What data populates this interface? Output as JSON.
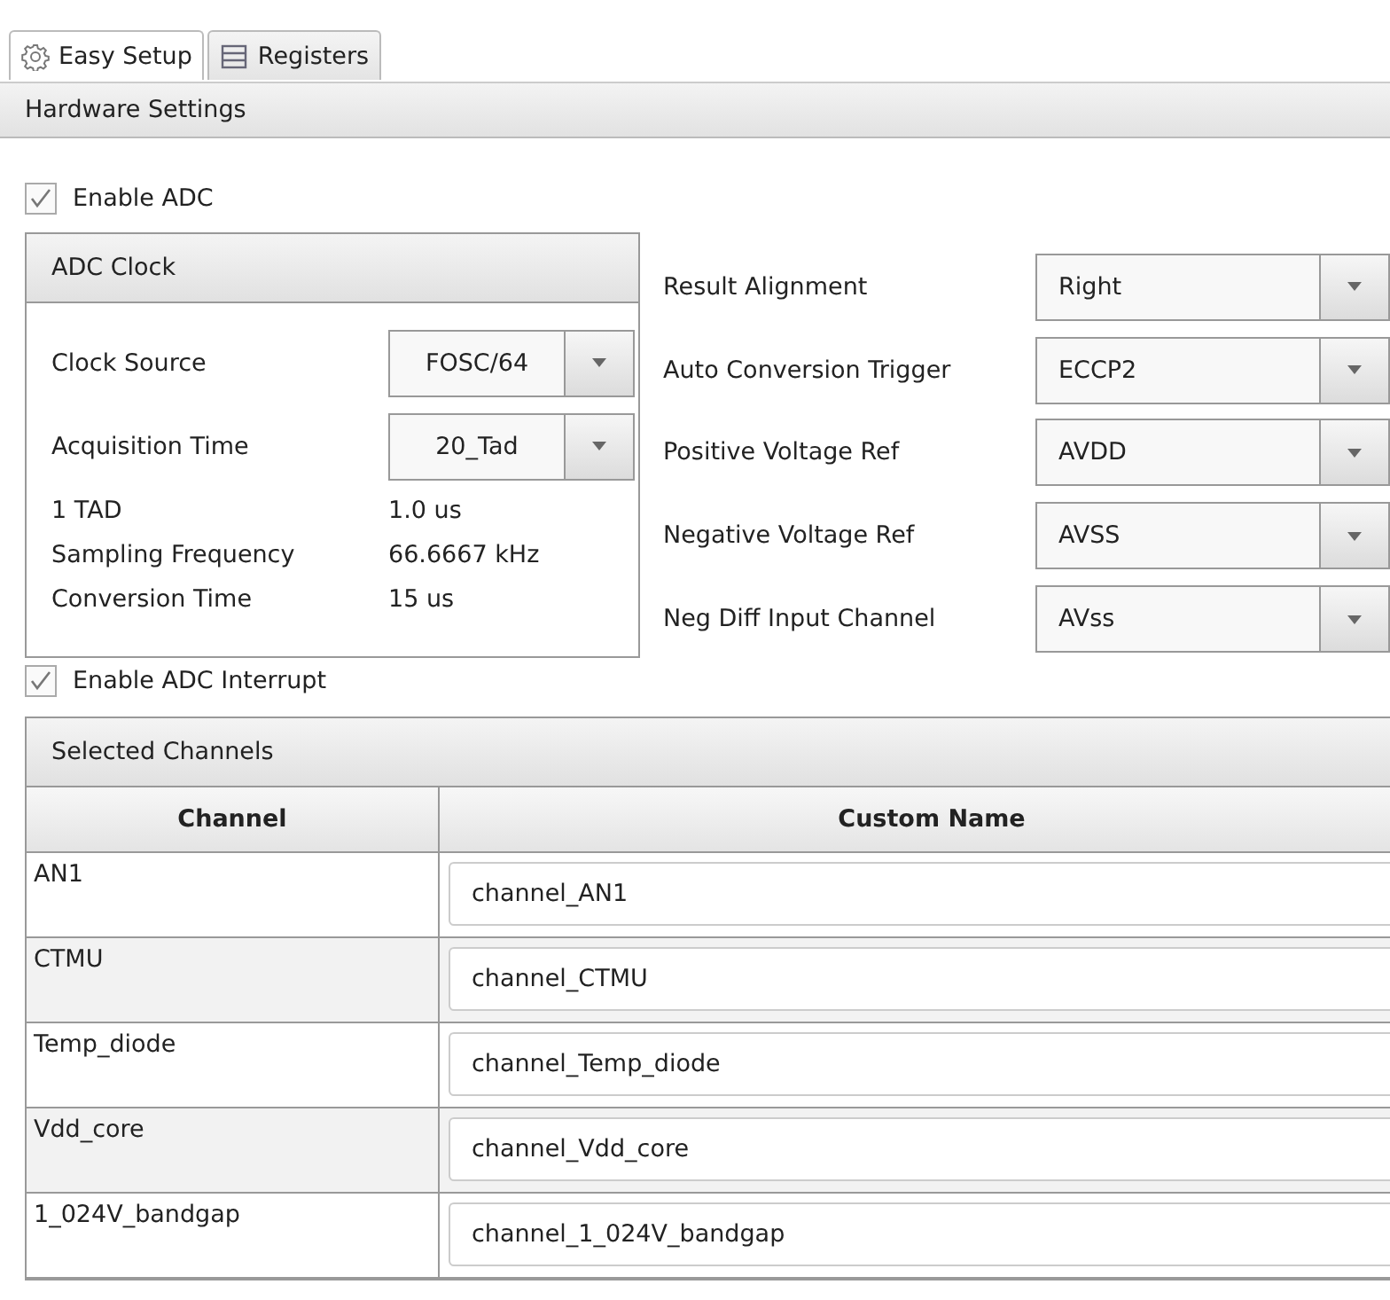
{
  "tabs": [
    {
      "label": "Easy Setup",
      "kind": "setup",
      "selected": true
    },
    {
      "label": "Registers",
      "kind": "registers",
      "selected": false
    }
  ],
  "section_title": "Hardware Settings",
  "enable_adc": {
    "label": "Enable ADC",
    "checked": true
  },
  "adc_clock": {
    "title": "ADC Clock",
    "dropdowns": [
      {
        "label": "Clock Source",
        "value": "FOSC/64"
      },
      {
        "label": "Acquisition Time",
        "value": "20_Tad"
      }
    ],
    "readouts": [
      {
        "label": "1 TAD",
        "value": "1.0 us"
      },
      {
        "label": "Sampling Frequency",
        "value": "66.6667 kHz"
      },
      {
        "label": "Conversion Time",
        "value": "15 us"
      }
    ]
  },
  "settings": [
    {
      "label": "Result Alignment",
      "value": "Right"
    },
    {
      "label": "Auto Conversion Trigger",
      "value": "ECCP2"
    },
    {
      "label": "Positive Voltage Ref",
      "value": "AVDD"
    },
    {
      "label": "Negative Voltage Ref",
      "value": "AVSS"
    },
    {
      "label": "Neg Diff Input Channel",
      "value": "AVss"
    }
  ],
  "enable_interrupt": {
    "label": "Enable ADC Interrupt",
    "checked": true
  },
  "selected_channels": {
    "title": "Selected Channels",
    "columns": [
      "Channel",
      "Custom Name"
    ],
    "rows": [
      {
        "channel": "AN1",
        "custom_name": "channel_AN1"
      },
      {
        "channel": "CTMU",
        "custom_name": "channel_CTMU"
      },
      {
        "channel": "Temp_diode",
        "custom_name": "channel_Temp_diode"
      },
      {
        "channel": "Vdd_core",
        "custom_name": "channel_Vdd_core"
      },
      {
        "channel": "1_024V_bandgap",
        "custom_name": "channel_1_024V_bandgap"
      }
    ]
  }
}
